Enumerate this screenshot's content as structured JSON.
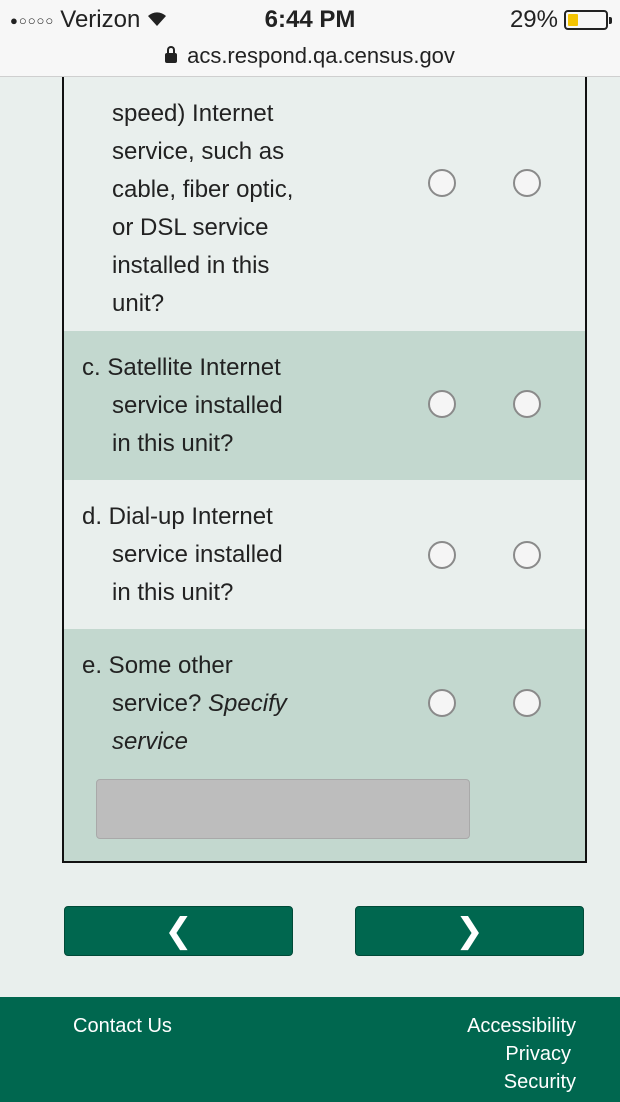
{
  "status": {
    "carrier": "Verizon",
    "time": "6:44 PM",
    "battery": "29%",
    "battery_level": 0.29
  },
  "browser": {
    "url": "acs.respond.qa.census.gov"
  },
  "questions": {
    "b": {
      "lines": [
        "speed) Internet",
        "service, such as",
        "cable, fiber optic,",
        "or DSL service",
        "installed in this",
        "unit?"
      ]
    },
    "c": {
      "first": "c. Satellite Internet",
      "lines": [
        "service installed",
        "in this unit?"
      ]
    },
    "d": {
      "first": "d. Dial-up Internet",
      "lines": [
        "service installed",
        "in this unit?"
      ]
    },
    "e": {
      "first": "e. Some other",
      "line2": "service? ",
      "line2_em": "Specify",
      "line3_em": "service",
      "specify_value": ""
    }
  },
  "nav": {
    "prev_icon": "chevron-left-icon",
    "next_icon": "chevron-right-icon",
    "prev_glyph": "❮",
    "next_glyph": "❯"
  },
  "footer": {
    "contact": "Contact Us",
    "accessibility": "Accessibility",
    "privacy": "Privacy",
    "security": "Security"
  },
  "colors": {
    "brand": "#00674f",
    "row_shade": "#c3d8cf",
    "page_bg": "#e9efed"
  }
}
